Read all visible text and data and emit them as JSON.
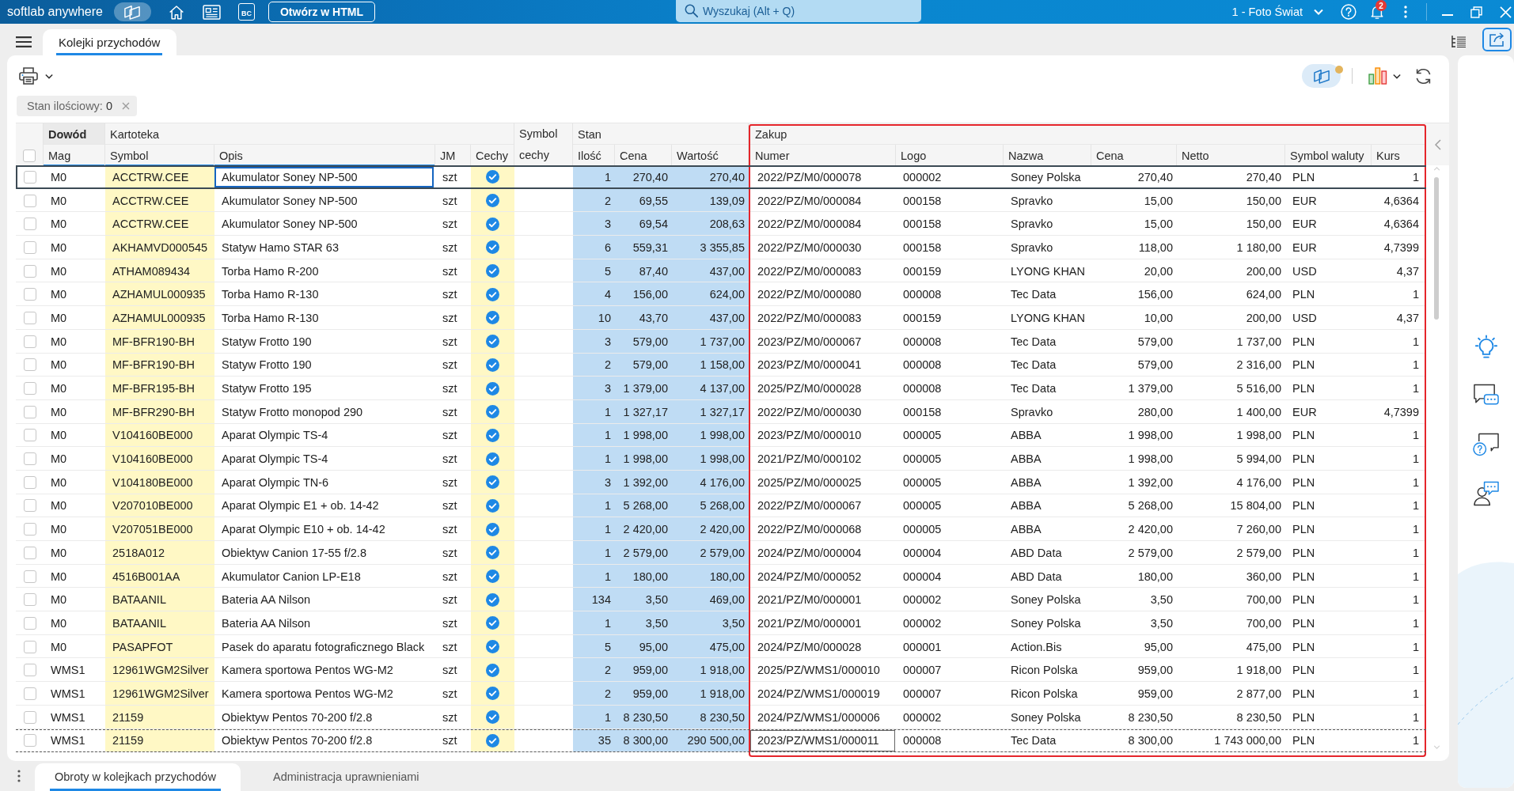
{
  "top_bar": {
    "app_name": "softlab anywhere",
    "bc_button": "BC",
    "html_button": "Otwórz w HTML",
    "search": {
      "placeholder": "Wyszukaj (Alt + Q)"
    },
    "company": "1 - Foto Świat",
    "notification_count": "2"
  },
  "tabs": [
    {
      "label": "Kolejki przychodów",
      "selected": true
    }
  ],
  "toolbar": {
    "view_toggle": {
      "on": true,
      "badge": true
    }
  },
  "filters": [
    {
      "label": "Stan ilościowy: **0**"
    }
  ],
  "table": {
    "select_all": {
      "checked": false
    },
    "groups": [
      {
        "label": "Dowód",
        "pinned": true,
        "highlighted": false,
        "columns": [
          {
            "label": "Mag",
            "kind": "text",
            "sorted": true
          }
        ]
      },
      {
        "label": "Kartoteka",
        "pinned": false,
        "highlighted": false,
        "columns": [
          {
            "label": "Symbol",
            "kind": "text",
            "sorted": true,
            "color": "#fff8c5"
          },
          {
            "label": "Opis",
            "kind": "text",
            "sorted": true
          },
          {
            "label": "JM",
            "kind": "text",
            "sorted": false
          },
          {
            "label": "Cechy",
            "kind": "check",
            "sorted": false,
            "color": "#fff8c5"
          }
        ]
      },
      {
        "pinned": false,
        "highlighted": false,
        "columns": [
          {
            "label": "Symbol cechy",
            "kind": "text",
            "sorted": false
          }
        ]
      },
      {
        "label": "Stan",
        "pinned": false,
        "highlighted": false,
        "columns": [
          {
            "label": "Ilość",
            "kind": "number",
            "sorted": false,
            "color": "#bfdcf4"
          },
          {
            "label": "Cena",
            "kind": "number",
            "sorted": false,
            "color": "#bfdcf4"
          },
          {
            "label": "Wartość",
            "kind": "number",
            "sorted": false,
            "color": "#bfdcf4"
          }
        ]
      },
      {
        "label": "Zakup",
        "pinned": false,
        "highlighted": true,
        "columns": [
          {
            "label": "Numer",
            "kind": "text",
            "sorted": false
          },
          {
            "label": "Logo",
            "kind": "text",
            "sorted": false
          },
          {
            "label": "Nazwa",
            "kind": "text",
            "sorted": false
          },
          {
            "label": "Cena",
            "kind": "number",
            "sorted": false
          },
          {
            "label": "Netto",
            "kind": "number",
            "sorted": false
          },
          {
            "label": "Symbol waluty",
            "kind": "text",
            "sorted": false
          },
          {
            "label": "Kurs",
            "kind": "number",
            "sorted": false
          }
        ]
      }
    ],
    "rows": [
      {
        "checked": false,
        "selected": true,
        "focused": false,
        "focus": {
          "opis": true
        },
        "mag": "M0",
        "symbol": "ACCTRW.CEE",
        "opis": "Akumulator Soney NP-500",
        "jm": "szt",
        "cechy": true,
        "ilosc": "1",
        "cena": "270,40",
        "wartosc": "270,40",
        "numer": "2022/PZ/M0/000078",
        "logo": "000002",
        "nazwa": "Soney Polska",
        "cena_zakupu": "270,40",
        "netto": "270,40",
        "waluta": "PLN",
        "kurs": "1"
      },
      {
        "checked": false,
        "selected": false,
        "focused": false,
        "mag": "M0",
        "symbol": "ACCTRW.CEE",
        "opis": "Akumulator Soney NP-500",
        "jm": "szt",
        "cechy": true,
        "ilosc": "2",
        "cena": "69,55",
        "wartosc": "139,09",
        "numer": "2022/PZ/M0/000084",
        "logo": "000158",
        "nazwa": "Spravko",
        "cena_zakupu": "15,00",
        "netto": "150,00",
        "waluta": "EUR",
        "kurs": "4,6364"
      },
      {
        "checked": false,
        "selected": false,
        "focused": false,
        "mag": "M0",
        "symbol": "ACCTRW.CEE",
        "opis": "Akumulator Soney NP-500",
        "jm": "szt",
        "cechy": true,
        "ilosc": "3",
        "cena": "69,54",
        "wartosc": "208,63",
        "numer": "2022/PZ/M0/000084",
        "logo": "000158",
        "nazwa": "Spravko",
        "cena_zakupu": "15,00",
        "netto": "150,00",
        "waluta": "EUR",
        "kurs": "4,6364"
      },
      {
        "checked": false,
        "selected": false,
        "focused": false,
        "mag": "M0",
        "symbol": "AKHAMVD000545",
        "opis": "Statyw Hamo STAR 63",
        "jm": "szt",
        "cechy": true,
        "ilosc": "6",
        "cena": "559,31",
        "wartosc": "3 355,85",
        "numer": "2022/PZ/M0/000030",
        "logo": "000158",
        "nazwa": "Spravko",
        "cena_zakupu": "118,00",
        "netto": "1 180,00",
        "waluta": "EUR",
        "kurs": "4,7399"
      },
      {
        "checked": false,
        "selected": false,
        "focused": false,
        "mag": "M0",
        "symbol": "ATHAM089434",
        "opis": "Torba Hamo R-200",
        "jm": "szt",
        "cechy": true,
        "ilosc": "5",
        "cena": "87,40",
        "wartosc": "437,00",
        "numer": "2022/PZ/M0/000083",
        "logo": "000159",
        "nazwa": "LYONG KHAN",
        "cena_zakupu": "20,00",
        "netto": "200,00",
        "waluta": "USD",
        "kurs": "4,37"
      },
      {
        "checked": false,
        "selected": false,
        "focused": false,
        "mag": "M0",
        "symbol": "AZHAMUL000935",
        "opis": "Torba Hamo R-130",
        "jm": "szt",
        "cechy": true,
        "ilosc": "4",
        "cena": "156,00",
        "wartosc": "624,00",
        "numer": "2022/PZ/M0/000080",
        "logo": "000008",
        "nazwa": "Tec Data",
        "cena_zakupu": "156,00",
        "netto": "624,00",
        "waluta": "PLN",
        "kurs": "1"
      },
      {
        "checked": false,
        "selected": false,
        "focused": false,
        "mag": "M0",
        "symbol": "AZHAMUL000935",
        "opis": "Torba Hamo R-130",
        "jm": "szt",
        "cechy": true,
        "ilosc": "10",
        "cena": "43,70",
        "wartosc": "437,00",
        "numer": "2022/PZ/M0/000083",
        "logo": "000159",
        "nazwa": "LYONG KHAN",
        "cena_zakupu": "10,00",
        "netto": "200,00",
        "waluta": "USD",
        "kurs": "4,37"
      },
      {
        "checked": false,
        "selected": false,
        "focused": false,
        "mag": "M0",
        "symbol": "MF-BFR190-BH",
        "opis": "Statyw Frotto 190",
        "jm": "szt",
        "cechy": true,
        "ilosc": "3",
        "cena": "579,00",
        "wartosc": "1 737,00",
        "numer": "2023/PZ/M0/000067",
        "logo": "000008",
        "nazwa": "Tec Data",
        "cena_zakupu": "579,00",
        "netto": "1 737,00",
        "waluta": "PLN",
        "kurs": "1"
      },
      {
        "checked": false,
        "selected": false,
        "focused": false,
        "mag": "M0",
        "symbol": "MF-BFR190-BH",
        "opis": "Statyw Frotto 190",
        "jm": "szt",
        "cechy": true,
        "ilosc": "2",
        "cena": "579,00",
        "wartosc": "1 158,00",
        "numer": "2023/PZ/M0/000041",
        "logo": "000008",
        "nazwa": "Tec Data",
        "cena_zakupu": "579,00",
        "netto": "2 316,00",
        "waluta": "PLN",
        "kurs": "1"
      },
      {
        "checked": false,
        "selected": false,
        "focused": false,
        "mag": "M0",
        "symbol": "MF-BFR195-BH",
        "opis": "Statyw Frotto 195",
        "jm": "szt",
        "cechy": true,
        "ilosc": "3",
        "cena": "1 379,00",
        "wartosc": "4 137,00",
        "numer": "2025/PZ/M0/000028",
        "logo": "000008",
        "nazwa": "Tec Data",
        "cena_zakupu": "1 379,00",
        "netto": "5 516,00",
        "waluta": "PLN",
        "kurs": "1"
      },
      {
        "checked": false,
        "selected": false,
        "focused": false,
        "mag": "M0",
        "symbol": "MF-BFR290-BH",
        "opis": "Statyw Frotto monopod 290",
        "jm": "szt",
        "cechy": true,
        "ilosc": "1",
        "cena": "1 327,17",
        "wartosc": "1 327,17",
        "numer": "2022/PZ/M0/000030",
        "logo": "000158",
        "nazwa": "Spravko",
        "cena_zakupu": "280,00",
        "netto": "1 400,00",
        "waluta": "EUR",
        "kurs": "4,7399"
      },
      {
        "checked": false,
        "selected": false,
        "focused": false,
        "mag": "M0",
        "symbol": "V104160BE000",
        "opis": "Aparat Olympic TS-4",
        "jm": "szt",
        "cechy": true,
        "ilosc": "1",
        "cena": "1 998,00",
        "wartosc": "1 998,00",
        "numer": "2023/PZ/M0/000010",
        "logo": "000005",
        "nazwa": "ABBA",
        "cena_zakupu": "1 998,00",
        "netto": "1 998,00",
        "waluta": "PLN",
        "kurs": "1"
      },
      {
        "checked": false,
        "selected": false,
        "focused": false,
        "mag": "M0",
        "symbol": "V104160BE000",
        "opis": "Aparat Olympic TS-4",
        "jm": "szt",
        "cechy": true,
        "ilosc": "1",
        "cena": "1 998,00",
        "wartosc": "1 998,00",
        "numer": "2021/PZ/M0/000102",
        "logo": "000005",
        "nazwa": "ABBA",
        "cena_zakupu": "1 998,00",
        "netto": "5 994,00",
        "waluta": "PLN",
        "kurs": "1"
      },
      {
        "checked": false,
        "selected": false,
        "focused": false,
        "mag": "M0",
        "symbol": "V104180BE000",
        "opis": "Aparat Olympic TN-6",
        "jm": "szt",
        "cechy": true,
        "ilosc": "3",
        "cena": "1 392,00",
        "wartosc": "4 176,00",
        "numer": "2025/PZ/M0/000025",
        "logo": "000005",
        "nazwa": "ABBA",
        "cena_zakupu": "1 392,00",
        "netto": "4 176,00",
        "waluta": "PLN",
        "kurs": "1"
      },
      {
        "checked": false,
        "selected": false,
        "focused": false,
        "mag": "M0",
        "symbol": "V207010BE000",
        "opis": "Aparat Olympic E1 + ob. 14-42",
        "jm": "szt",
        "cechy": true,
        "ilosc": "1",
        "cena": "5 268,00",
        "wartosc": "5 268,00",
        "numer": "2022/PZ/M0/000067",
        "logo": "000005",
        "nazwa": "ABBA",
        "cena_zakupu": "5 268,00",
        "netto": "15 804,00",
        "waluta": "PLN",
        "kurs": "1"
      },
      {
        "checked": false,
        "selected": false,
        "focused": false,
        "mag": "M0",
        "symbol": "V207051BE000",
        "opis": "Aparat Olympic E10 + ob. 14-42",
        "jm": "szt",
        "cechy": true,
        "ilosc": "1",
        "cena": "2 420,00",
        "wartosc": "2 420,00",
        "numer": "2022/PZ/M0/000068",
        "logo": "000005",
        "nazwa": "ABBA",
        "cena_zakupu": "2 420,00",
        "netto": "7 260,00",
        "waluta": "PLN",
        "kurs": "1"
      },
      {
        "checked": false,
        "selected": false,
        "focused": false,
        "mag": "M0",
        "symbol": "2518A012",
        "opis": "Obiektyw Canion 17-55 f/2.8",
        "jm": "szt",
        "cechy": true,
        "ilosc": "1",
        "cena": "2 579,00",
        "wartosc": "2 579,00",
        "numer": "2024/PZ/M0/000004",
        "logo": "000004",
        "nazwa": "ABD Data",
        "cena_zakupu": "2 579,00",
        "netto": "2 579,00",
        "waluta": "PLN",
        "kurs": "1"
      },
      {
        "checked": false,
        "selected": false,
        "focused": false,
        "mag": "M0",
        "symbol": "4516B001AA",
        "opis": "Akumulator Canion LP-E18",
        "jm": "szt",
        "cechy": true,
        "ilosc": "1",
        "cena": "180,00",
        "wartosc": "180,00",
        "numer": "2024/PZ/M0/000052",
        "logo": "000004",
        "nazwa": "ABD Data",
        "cena_zakupu": "180,00",
        "netto": "360,00",
        "waluta": "PLN",
        "kurs": "1"
      },
      {
        "checked": false,
        "selected": false,
        "focused": false,
        "mag": "M0",
        "symbol": "BATAANIL",
        "opis": "Bateria AA Nilson",
        "jm": "szt",
        "cechy": true,
        "ilosc": "134",
        "cena": "3,50",
        "wartosc": "469,00",
        "numer": "2021/PZ/M0/000001",
        "logo": "000002",
        "nazwa": "Soney Polska",
        "cena_zakupu": "3,50",
        "netto": "700,00",
        "waluta": "PLN",
        "kurs": "1"
      },
      {
        "checked": false,
        "selected": false,
        "focused": false,
        "mag": "M0",
        "symbol": "BATAANIL",
        "opis": "Bateria AA Nilson",
        "jm": "szt",
        "cechy": true,
        "ilosc": "1",
        "cena": "3,50",
        "wartosc": "3,50",
        "numer": "2021/PZ/M0/000001",
        "logo": "000002",
        "nazwa": "Soney Polska",
        "cena_zakupu": "3,50",
        "netto": "700,00",
        "waluta": "PLN",
        "kurs": "1"
      },
      {
        "checked": false,
        "selected": false,
        "focused": false,
        "mag": "M0",
        "symbol": "PASAPFOT",
        "opis": "Pasek do aparatu fotograficznego Black",
        "jm": "szt",
        "cechy": true,
        "ilosc": "5",
        "cena": "95,00",
        "wartosc": "475,00",
        "numer": "2024/PZ/M0/000028",
        "logo": "000001",
        "nazwa": "Action.Bis",
        "cena_zakupu": "95,00",
        "netto": "475,00",
        "waluta": "PLN",
        "kurs": "1"
      },
      {
        "checked": false,
        "selected": false,
        "focused": false,
        "mag": "WMS1",
        "symbol": "12961WGM2Silver",
        "opis": "Kamera sportowa Pentos WG-M2",
        "jm": "szt",
        "cechy": true,
        "ilosc": "2",
        "cena": "959,00",
        "wartosc": "1 918,00",
        "numer": "2025/PZ/WMS1/000010",
        "logo": "000007",
        "nazwa": "Ricon Polska",
        "cena_zakupu": "959,00",
        "netto": "1 918,00",
        "waluta": "PLN",
        "kurs": "1"
      },
      {
        "checked": false,
        "selected": false,
        "focused": false,
        "mag": "WMS1",
        "symbol": "12961WGM2Silver",
        "opis": "Kamera sportowa Pentos WG-M2",
        "jm": "szt",
        "cechy": true,
        "ilosc": "2",
        "cena": "959,00",
        "wartosc": "1 918,00",
        "numer": "2024/PZ/WMS1/000019",
        "logo": "000007",
        "nazwa": "Ricon Polska",
        "cena_zakupu": "959,00",
        "netto": "2 877,00",
        "waluta": "PLN",
        "kurs": "1"
      },
      {
        "checked": false,
        "selected": false,
        "focused": false,
        "mag": "WMS1",
        "symbol": "21159",
        "opis": "Obiektyw Pentos 70-200 f/2.8",
        "jm": "szt",
        "cechy": true,
        "ilosc": "1",
        "cena": "8 230,50",
        "wartosc": "8 230,50",
        "numer": "2024/PZ/WMS1/000006",
        "logo": "000002",
        "nazwa": "Soney Polska",
        "cena_zakupu": "8 230,50",
        "netto": "8 230,50",
        "waluta": "PLN",
        "kurs": "1"
      },
      {
        "checked": false,
        "selected": false,
        "focused": true,
        "focus": {
          "numer": true
        },
        "mag": "WMS1",
        "symbol": "21159",
        "opis": "Obiektyw Pentos 70-200 f/2.8",
        "jm": "szt",
        "cechy": true,
        "ilosc": "35",
        "cena": "8 300,00",
        "wartosc": "290 500,00",
        "numer": "2023/PZ/WMS1/000011",
        "logo": "000008",
        "nazwa": "Tec Data",
        "cena_zakupu": "8 300,00",
        "netto": "1 743 000,00",
        "waluta": "PLN",
        "kurs": "1"
      }
    ]
  },
  "bottom_tabs": [
    {
      "label": "Obroty w kolejkach przychodów",
      "selected": true
    },
    {
      "label": "Administracja uprawnieniami",
      "selected": false
    }
  ]
}
